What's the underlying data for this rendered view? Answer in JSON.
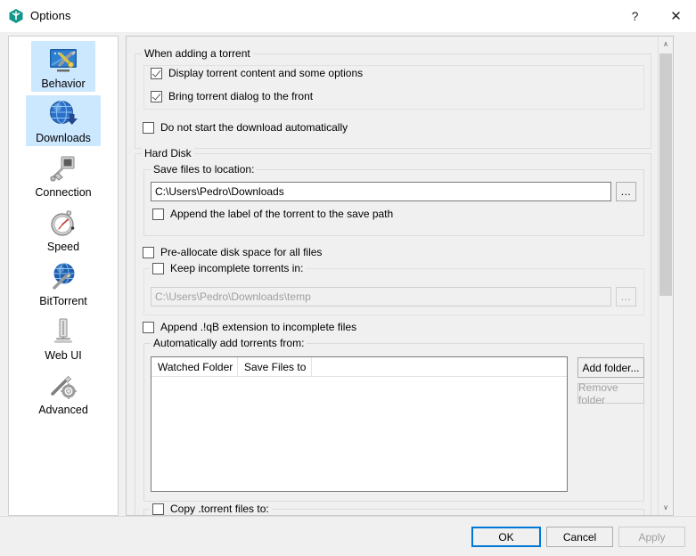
{
  "window": {
    "title": "Options",
    "icon": "qbittorrent-cube-icon",
    "help_label": "?",
    "close_label": "✕",
    "accent": "#0078d7",
    "brand_color": "#12968a",
    "selection_color": "#cce8ff"
  },
  "sidebar": {
    "items": [
      {
        "label": "Behavior",
        "icon": "behavior-icon",
        "selected": true
      },
      {
        "label": "Downloads",
        "icon": "downloads-icon",
        "selected": true
      },
      {
        "label": "Connection",
        "icon": "connection-icon",
        "selected": false
      },
      {
        "label": "Speed",
        "icon": "speed-icon",
        "selected": false
      },
      {
        "label": "BitTorrent",
        "icon": "bittorrent-icon",
        "selected": false
      },
      {
        "label": "Web UI",
        "icon": "webui-icon",
        "selected": false
      },
      {
        "label": "Advanced",
        "icon": "advanced-icon",
        "selected": false
      }
    ]
  },
  "pane": {
    "when_adding": {
      "group_label": "When adding a torrent",
      "display_content": {
        "label": "Display torrent content and some options",
        "checked": true
      },
      "bring_front": {
        "label": "Bring torrent dialog to the front",
        "checked": true
      },
      "do_not_start": {
        "label": "Do not start the download automatically",
        "checked": false
      }
    },
    "hard_disk": {
      "group_label": "Hard Disk",
      "save_location": {
        "group_label": "Save files to location:",
        "value": "C:\\Users\\Pedro\\Downloads",
        "browse_label": "...",
        "append_label": {
          "label": "Append the label of the torrent to the save path",
          "checked": false
        }
      },
      "preallocate": {
        "label": "Pre-allocate disk space for all files",
        "checked": false
      },
      "incomplete": {
        "group_label": "Keep incomplete torrents in:",
        "checked": false,
        "value": "C:\\Users\\Pedro\\Downloads\\temp",
        "browse_label": "...",
        "disabled": true
      },
      "append_qb": {
        "label": "Append .!qB extension to incomplete files",
        "checked": false
      },
      "auto_add": {
        "group_label": "Automatically add torrents from:",
        "columns": [
          "Watched Folder",
          "Save Files to"
        ],
        "rows": [],
        "add_folder_label": "Add folder...",
        "remove_folder_label": "Remove folder",
        "remove_disabled": true
      },
      "copy_torrent": {
        "label": "Copy .torrent files to:",
        "checked": false
      }
    },
    "scrollbar": {
      "up_arrow": "∧",
      "down_arrow": "∨"
    }
  },
  "footer": {
    "ok_label": "OK",
    "cancel_label": "Cancel",
    "apply_label": "Apply",
    "apply_disabled": true
  }
}
